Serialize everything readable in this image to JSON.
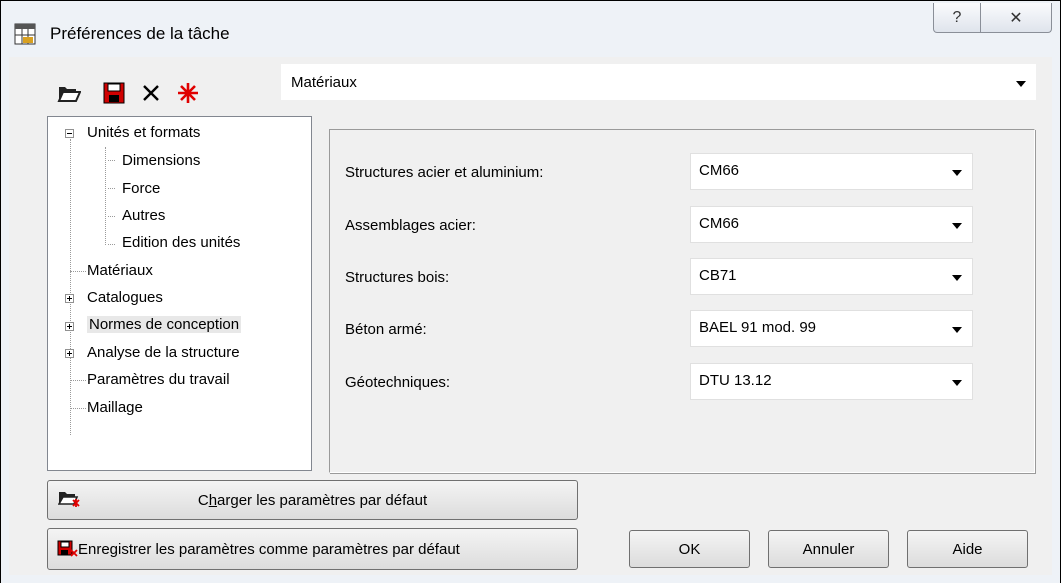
{
  "window": {
    "title": "Préférences de la tâche",
    "help_glyph": "?",
    "close_glyph": "✕"
  },
  "toolbar": {
    "open_icon": "open-folder-icon",
    "save_icon": "save-icon",
    "delete_icon": "delete-x-icon",
    "reset_icon": "red-star-icon"
  },
  "category_select": {
    "value": "Matériaux"
  },
  "tree": {
    "units": "Unités et formats",
    "dimensions": "Dimensions",
    "force": "Force",
    "autres": "Autres",
    "edition": "Edition des unités",
    "materiaux": "Matériaux",
    "catalogues": "Catalogues",
    "normes": "Normes de conception",
    "analyse": "Analyse de la structure",
    "parametres": "Paramètres du travail",
    "maillage": "Maillage"
  },
  "settings": {
    "steel_label": "Structures acier et aluminium:",
    "steel_value": "CM66",
    "connections_label": "Assemblages acier:",
    "connections_value": "CM66",
    "timber_label": "Structures bois:",
    "timber_value": "CB71",
    "concrete_label": "Béton armé:",
    "concrete_value": "BAEL 91 mod. 99",
    "geotech_label": "Géotechniques:",
    "geotech_value": "DTU 13.12"
  },
  "buttons": {
    "load_defaults_pre": "C",
    "load_defaults_ul": "h",
    "load_defaults_post": "arger les paramètres par défaut",
    "save_defaults": "Enregistrer les paramètres comme paramètres par défaut",
    "ok": "OK",
    "cancel": "Annuler",
    "help": "Aide"
  }
}
